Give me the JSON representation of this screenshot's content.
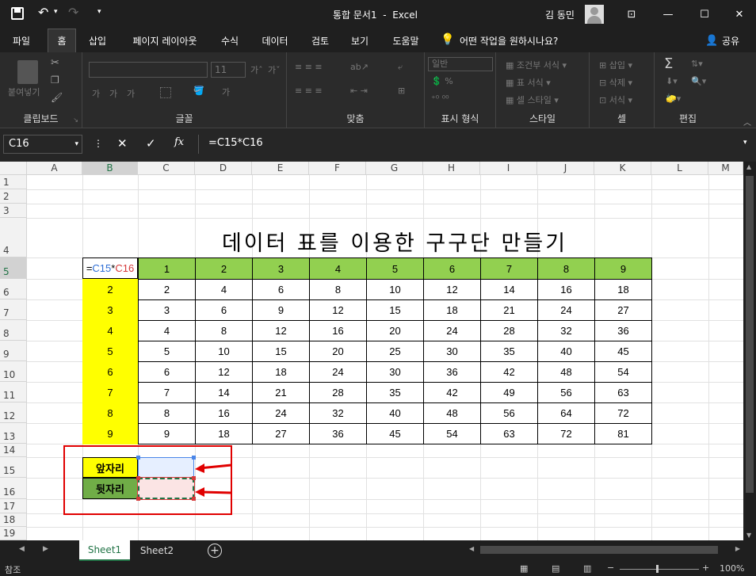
{
  "window": {
    "title": "통합 문서1  -  Excel",
    "user": "김 동민"
  },
  "ribbon_tabs": [
    "파일",
    "홈",
    "삽입",
    "페이지 레이아웃",
    "수식",
    "데이터",
    "검토",
    "보기",
    "도움말"
  ],
  "tell_me": "어떤 작업을 원하시나요?",
  "share": "공유",
  "groups": {
    "clipboard": "클립보드",
    "font": "글꼴",
    "align": "맞춤",
    "number": "표시 형식",
    "style": "스타일",
    "cells": "셀",
    "edit": "편집"
  },
  "ribbon_cmds": {
    "paste": "붙여넣기",
    "font_size": "11",
    "number_format": "일반",
    "cond_format": "조건부 서식",
    "table_format": "표 서식",
    "cell_style": "셀 스타일",
    "insert": "삽입",
    "delete": "삭제",
    "format": "서식"
  },
  "namebox": "C16",
  "formula": "=C15*C16",
  "columns": [
    "A",
    "B",
    "C",
    "D",
    "E",
    "F",
    "G",
    "H",
    "I",
    "J",
    "K",
    "L",
    "M"
  ],
  "rows": [
    "1",
    "2",
    "3",
    "4",
    "5",
    "6",
    "7",
    "8",
    "9",
    "10",
    "11",
    "12",
    "13",
    "14",
    "15",
    "16",
    "17",
    "18",
    "19"
  ],
  "table_title": "데이터 표를 이용한 구구단 만들기",
  "header_formula": {
    "a": "=",
    "b": "C15",
    "c": "*",
    "d": "C16"
  },
  "table": {
    "col_headers": [
      "1",
      "2",
      "3",
      "4",
      "5",
      "6",
      "7",
      "8",
      "9"
    ],
    "row_headers": [
      "2",
      "3",
      "4",
      "5",
      "6",
      "7",
      "8",
      "9"
    ],
    "values": [
      [
        "2",
        "4",
        "6",
        "8",
        "10",
        "12",
        "14",
        "16",
        "18"
      ],
      [
        "3",
        "6",
        "9",
        "12",
        "15",
        "18",
        "21",
        "24",
        "27"
      ],
      [
        "4",
        "8",
        "12",
        "16",
        "20",
        "24",
        "28",
        "32",
        "36"
      ],
      [
        "5",
        "10",
        "15",
        "20",
        "25",
        "30",
        "35",
        "40",
        "45"
      ],
      [
        "6",
        "12",
        "18",
        "24",
        "30",
        "36",
        "42",
        "48",
        "54"
      ],
      [
        "7",
        "14",
        "21",
        "28",
        "35",
        "42",
        "49",
        "56",
        "63"
      ],
      [
        "8",
        "16",
        "24",
        "32",
        "40",
        "48",
        "56",
        "64",
        "72"
      ],
      [
        "9",
        "18",
        "27",
        "36",
        "45",
        "54",
        "63",
        "72",
        "81"
      ]
    ]
  },
  "inputs": {
    "front_label": "앞자리",
    "back_label": "뒷자리"
  },
  "sheets": [
    "Sheet1",
    "Sheet2"
  ],
  "status": {
    "mode": "참조",
    "zoom": "100%"
  },
  "colors": {
    "green": "#92d050",
    "yellow": "#ffff00",
    "red": "#e00000",
    "accent": "#217346"
  }
}
